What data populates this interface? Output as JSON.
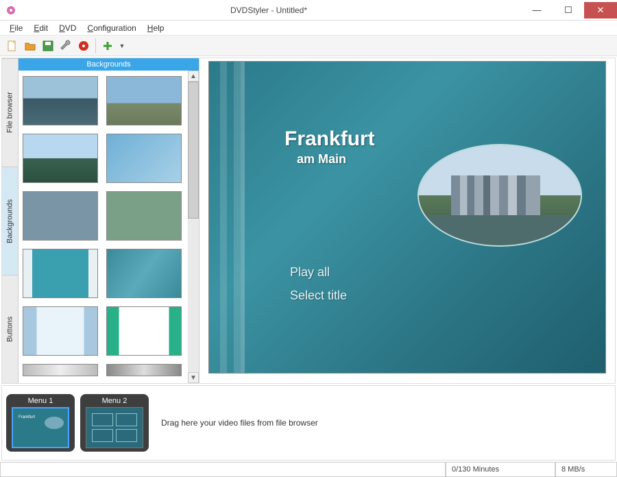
{
  "window": {
    "title": "DVDStyler - Untitled*"
  },
  "menu": {
    "file": "File",
    "edit": "Edit",
    "dvd": "DVD",
    "config": "Configuration",
    "help": "Help"
  },
  "toolbar": {
    "new": "new-file-icon",
    "open": "open-folder-icon",
    "save": "save-icon",
    "settings": "settings-icon",
    "burn": "burn-disc-icon",
    "add": "add-icon"
  },
  "sidetabs": {
    "file_browser": "File browser",
    "backgrounds": "Backgrounds",
    "buttons": "Buttons"
  },
  "panel": {
    "title": "Backgrounds"
  },
  "dvd_menu": {
    "title": "Frankfurt",
    "subtitle": "am Main",
    "items": [
      "Play all",
      "Select title"
    ]
  },
  "timeline": {
    "menu1": "Menu 1",
    "menu2": "Menu 2",
    "hint": "Drag here your video files from file browser"
  },
  "status": {
    "minutes": "0/130 Minutes",
    "rate": "8 MB/s"
  }
}
